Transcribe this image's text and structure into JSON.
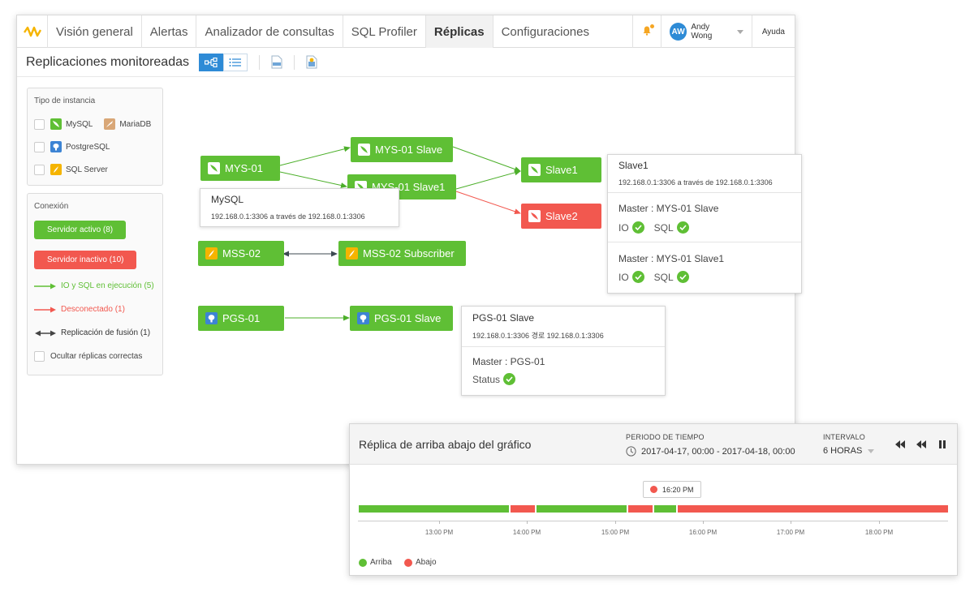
{
  "nav": {
    "tabs": [
      "Visión general",
      "Alertas",
      "Analizador de consultas",
      "SQL Profiler",
      "Réplicas",
      "Configuraciones"
    ],
    "active_tab": "Réplicas",
    "user_initials": "AW",
    "user_name": "Andy Wong",
    "help": "Ayuda"
  },
  "page": {
    "title": "Replicaciones monitoreadas"
  },
  "filters": {
    "instance_title": "Tipo de instancia",
    "instance_types": [
      "MySQL",
      "MariaDB",
      "PostgreSQL",
      "SQL Server"
    ],
    "connection_title": "Conexión",
    "active_server": "Servidor activo  (8)",
    "inactive_server": "Servidor inactivo  (10)",
    "legend_running": "IO y SQL en ejecución (5)",
    "legend_disconnected": "Desconectado (1)",
    "legend_merge": "Replicación de fusión (1)",
    "hide_correct": "Ocultar réplicas correctas"
  },
  "nodes": {
    "mys01": "MYS-01",
    "mys01_slave": "MYS-01 Slave",
    "mys01_slave1": "MYS-01 Slave1",
    "slave1": "Slave1",
    "slave2": "Slave2",
    "mss02": "MSS-02",
    "mss02_sub": "MSS-02 Subscriber",
    "pgs01": "PGS-01",
    "pgs01_slave": "PGS-01 Slave"
  },
  "popup_mysql": {
    "title": "MySQL",
    "address": "192.168.0.1:3306 a través de 192.168.0.1:3306"
  },
  "popup_slave1": {
    "title": "Slave1",
    "address": "192.168.0.1:3306 a través de 192.168.0.1:3306",
    "master1": "Master : MYS-01 Slave",
    "master2": "Master : MYS-01 Slave1",
    "io": "IO",
    "sql": "SQL"
  },
  "popup_pgs": {
    "title": "PGS-01 Slave",
    "address": "192.168.0.1:3306 경로 192.168.0.1:3306",
    "master": "Master : PGS-01",
    "status": "Status"
  },
  "timeline": {
    "title": "Réplica de arriba abajo del gráfico",
    "period_label": "PERIODO DE TIEMPO",
    "period_value": "2017-04-17, 00:00 - 2017-04-18, 00:00",
    "interval_label": "INTERVALO",
    "interval_value": "6 HORAS",
    "marker": "16:20 PM",
    "ticks": [
      "13:00 PM",
      "14:00 PM",
      "15:00 PM",
      "16:00 PM",
      "17:00 PM",
      "18:00 PM"
    ],
    "legend_up": "Arriba",
    "legend_down": "Abajo",
    "colors": {
      "up": "#5fbf35",
      "down": "#f2584f"
    }
  }
}
